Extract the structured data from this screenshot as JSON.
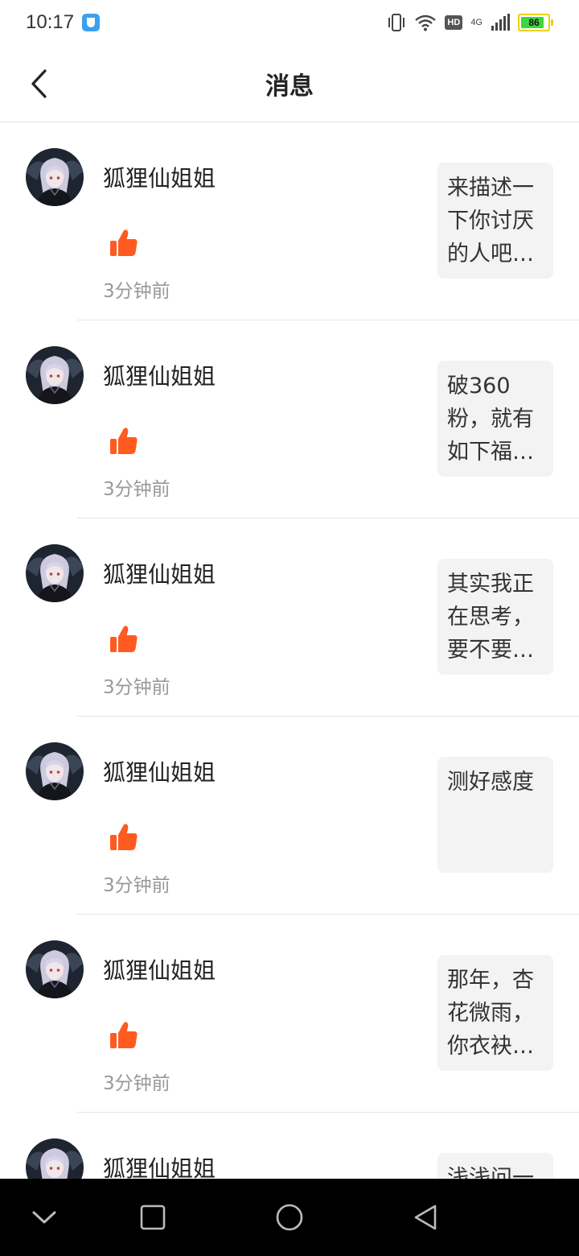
{
  "status_bar": {
    "time": "10:17",
    "network": "4G",
    "hd_label": "HD",
    "battery_level": "86",
    "battery_fraction": 0.86,
    "icons": [
      "shield-app-icon",
      "vibrate-icon",
      "wifi-icon",
      "hd-icon",
      "signal-icon",
      "battery-icon"
    ]
  },
  "header": {
    "title": "消息",
    "back_icon": "chevron-left-icon"
  },
  "colors": {
    "like": "#ff5a1f",
    "divider": "#e6e6e6",
    "card_bg": "#f3f3f3",
    "muted_text": "#999999",
    "nav_bg": "#000000"
  },
  "messages": [
    {
      "user": "狐狸仙姐姐",
      "icon": "thumbs-up-icon",
      "time": "3分钟前",
      "preview": "来描述一下你讨厌的人吧…"
    },
    {
      "user": "狐狸仙姐姐",
      "icon": "thumbs-up-icon",
      "time": "3分钟前",
      "preview": "破360粉，就有如下福…"
    },
    {
      "user": "狐狸仙姐姐",
      "icon": "thumbs-up-icon",
      "time": "3分钟前",
      "preview": "其实我正在思考，要不要…"
    },
    {
      "user": "狐狸仙姐姐",
      "icon": "thumbs-up-icon",
      "time": "3分钟前",
      "preview": "测好感度"
    },
    {
      "user": "狐狸仙姐姐",
      "icon": "thumbs-up-icon",
      "time": "3分钟前",
      "preview": "那年，杏花微雨，你衣袂…"
    },
    {
      "user": "狐狸仙姐姐",
      "icon": "thumbs-up-icon",
      "time": "",
      "preview": "浅浅问一"
    }
  ],
  "nav_bar": {
    "buttons": [
      "chevron-down-icon",
      "square-icon",
      "circle-icon",
      "triangle-back-icon"
    ]
  }
}
